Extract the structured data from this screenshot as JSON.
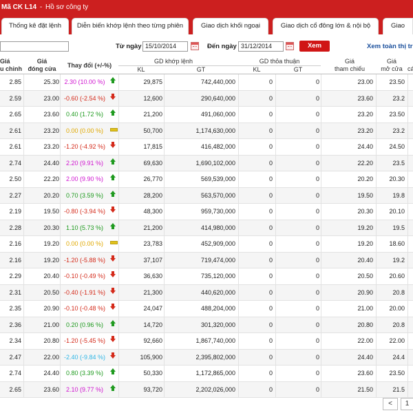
{
  "topbar": {
    "code": "Mã CK L14",
    "separator": "-",
    "profile": "Hồ sơ công ty"
  },
  "tabs": [
    {
      "label": "Thống kê đặt lệnh"
    },
    {
      "label": "Diễn biến khớp lệnh theo từng phiên"
    },
    {
      "label": "Giao dịch khối ngoại"
    },
    {
      "label": "Giao dịch cổ đông lớn & nội bộ"
    },
    {
      "label": "Giao"
    }
  ],
  "filter": {
    "from_label": "Từ ngày",
    "from_value": "15/10/2014",
    "to_label": "Đến ngày",
    "to_value": "31/12/2014",
    "submit_label": "Xem",
    "view_all_label": "Xem toàn thị trư"
  },
  "headers": {
    "adjusted": [
      "Giá",
      "u chỉnh"
    ],
    "close": [
      "Giá",
      "đóng cửa"
    ],
    "change": "Thay đổi (+/-%)",
    "matched_group": "GD khớp lệnh",
    "agreed_group": "GD thỏa thuận",
    "kl": "KL",
    "gt": "GT",
    "reference": [
      "Giá",
      "tham chiếu"
    ],
    "open": [
      "Giá",
      "mở cửa"
    ],
    "next": "cá"
  },
  "colors": {
    "up": "#d016d0",
    "down": "#d42a1a",
    "flat": "#e0a800",
    "green": "#1f9a1f",
    "cyan": "#2fb6e6",
    "brand": "#cc1f1f"
  },
  "rows": [
    {
      "adj": "2.85",
      "close": "25.30",
      "change": "2.30 (10.00 %)",
      "dir": "up",
      "tone": "up",
      "kl": "29,875",
      "gt": "742,440,000",
      "tkl": "0",
      "tgt": "0",
      "ref": "23.00",
      "open": "23.50"
    },
    {
      "adj": "2.59",
      "close": "23.00",
      "change": "-0.60 (-2.54 %)",
      "dir": "down",
      "tone": "down",
      "kl": "12,600",
      "gt": "290,640,000",
      "tkl": "0",
      "tgt": "0",
      "ref": "23.60",
      "open": "23.2"
    },
    {
      "adj": "2.65",
      "close": "23.60",
      "change": "0.40 (1.72 %)",
      "dir": "up",
      "tone": "green",
      "kl": "21,200",
      "gt": "491,060,000",
      "tkl": "0",
      "tgt": "0",
      "ref": "23.20",
      "open": "23.50"
    },
    {
      "adj": "2.61",
      "close": "23.20",
      "change": "0.00 (0.00 %)",
      "dir": "flat",
      "tone": "flat",
      "kl": "50,700",
      "gt": "1,174,630,000",
      "tkl": "0",
      "tgt": "0",
      "ref": "23.20",
      "open": "23.2"
    },
    {
      "adj": "2.61",
      "close": "23.20",
      "change": "-1.20 (-4.92 %)",
      "dir": "down",
      "tone": "down",
      "kl": "17,815",
      "gt": "416,482,000",
      "tkl": "0",
      "tgt": "0",
      "ref": "24.40",
      "open": "24.50"
    },
    {
      "adj": "2.74",
      "close": "24.40",
      "change": "2.20 (9.91 %)",
      "dir": "up",
      "tone": "up",
      "kl": "69,630",
      "gt": "1,690,102,000",
      "tkl": "0",
      "tgt": "0",
      "ref": "22.20",
      "open": "23.5"
    },
    {
      "adj": "2.50",
      "close": "22.20",
      "change": "2.00 (9.90 %)",
      "dir": "up",
      "tone": "up",
      "kl": "26,770",
      "gt": "569,539,000",
      "tkl": "0",
      "tgt": "0",
      "ref": "20.20",
      "open": "20.30"
    },
    {
      "adj": "2.27",
      "close": "20.20",
      "change": "0.70 (3.59 %)",
      "dir": "up",
      "tone": "green",
      "kl": "28,200",
      "gt": "563,570,000",
      "tkl": "0",
      "tgt": "0",
      "ref": "19.50",
      "open": "19.8"
    },
    {
      "adj": "2.19",
      "close": "19.50",
      "change": "-0.80 (-3.94 %)",
      "dir": "down",
      "tone": "down",
      "kl": "48,300",
      "gt": "959,730,000",
      "tkl": "0",
      "tgt": "0",
      "ref": "20.30",
      "open": "20.10"
    },
    {
      "adj": "2.28",
      "close": "20.30",
      "change": "1.10 (5.73 %)",
      "dir": "up",
      "tone": "green",
      "kl": "21,200",
      "gt": "414,980,000",
      "tkl": "0",
      "tgt": "0",
      "ref": "19.20",
      "open": "19.5"
    },
    {
      "adj": "2.16",
      "close": "19.20",
      "change": "0.00 (0.00 %)",
      "dir": "flat",
      "tone": "flat",
      "kl": "23,783",
      "gt": "452,909,000",
      "tkl": "0",
      "tgt": "0",
      "ref": "19.20",
      "open": "18.60"
    },
    {
      "adj": "2.16",
      "close": "19.20",
      "change": "-1.20 (-5.88 %)",
      "dir": "down",
      "tone": "down",
      "kl": "37,107",
      "gt": "719,474,000",
      "tkl": "0",
      "tgt": "0",
      "ref": "20.40",
      "open": "19.2"
    },
    {
      "adj": "2.29",
      "close": "20.40",
      "change": "-0.10 (-0.49 %)",
      "dir": "down",
      "tone": "down",
      "kl": "36,630",
      "gt": "735,120,000",
      "tkl": "0",
      "tgt": "0",
      "ref": "20.50",
      "open": "20.60"
    },
    {
      "adj": "2.31",
      "close": "20.50",
      "change": "-0.40 (-1.91 %)",
      "dir": "down",
      "tone": "down",
      "kl": "21,300",
      "gt": "440,620,000",
      "tkl": "0",
      "tgt": "0",
      "ref": "20.90",
      "open": "20.8"
    },
    {
      "adj": "2.35",
      "close": "20.90",
      "change": "-0.10 (-0.48 %)",
      "dir": "down",
      "tone": "down",
      "kl": "24,047",
      "gt": "488,204,000",
      "tkl": "0",
      "tgt": "0",
      "ref": "21.00",
      "open": "20.00"
    },
    {
      "adj": "2.36",
      "close": "21.00",
      "change": "0.20 (0.96 %)",
      "dir": "up",
      "tone": "green",
      "kl": "14,720",
      "gt": "301,320,000",
      "tkl": "0",
      "tgt": "0",
      "ref": "20.80",
      "open": "20.8"
    },
    {
      "adj": "2.34",
      "close": "20.80",
      "change": "-1.20 (-5.45 %)",
      "dir": "down",
      "tone": "down",
      "kl": "92,660",
      "gt": "1,867,740,000",
      "tkl": "0",
      "tgt": "0",
      "ref": "22.00",
      "open": "22.00"
    },
    {
      "adj": "2.47",
      "close": "22.00",
      "change": "-2.40 (-9.84 %)",
      "dir": "down",
      "tone": "cyan",
      "kl": "105,900",
      "gt": "2,395,802,000",
      "tkl": "0",
      "tgt": "0",
      "ref": "24.40",
      "open": "24.4"
    },
    {
      "adj": "2.74",
      "close": "24.40",
      "change": "0.80 (3.39 %)",
      "dir": "up",
      "tone": "green",
      "kl": "50,330",
      "gt": "1,172,865,000",
      "tkl": "0",
      "tgt": "0",
      "ref": "23.60",
      "open": "23.50"
    },
    {
      "adj": "2.65",
      "close": "23.60",
      "change": "2.10 (9.77 %)",
      "dir": "up",
      "tone": "up",
      "kl": "93,720",
      "gt": "2,202,026,000",
      "tkl": "0",
      "tgt": "0",
      "ref": "21.50",
      "open": "21.5"
    }
  ],
  "pager": {
    "prev": "<",
    "page": "1"
  }
}
